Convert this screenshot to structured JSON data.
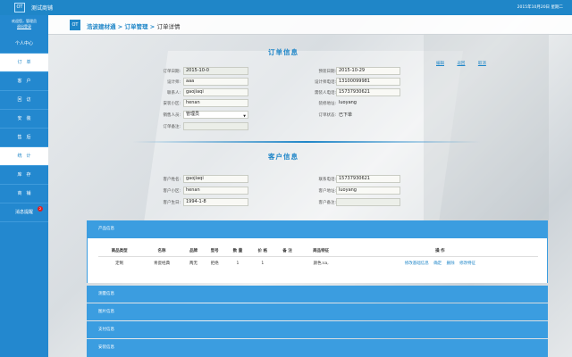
{
  "topbar": {
    "logo": "OT",
    "title": "测试商铺",
    "date": "2015年10月20日 星期二"
  },
  "sidebar": {
    "welcome": "欢迎您，管理员",
    "logout": "退出登录",
    "items": [
      {
        "label": "个人中心"
      },
      {
        "label": "订　单"
      },
      {
        "label": "客　户"
      },
      {
        "label": "回　访"
      },
      {
        "label": "安　装"
      },
      {
        "label": "售　后"
      },
      {
        "label": "统　计"
      },
      {
        "label": "库　存"
      },
      {
        "label": "商　铺"
      },
      {
        "label": "消息提醒",
        "badge": "2"
      }
    ]
  },
  "breadcrumb": {
    "icon": "OT",
    "path": "浩波建材通 > 订单管理 > ",
    "current": "订单详情"
  },
  "order": {
    "title": "订单信息",
    "actions": {
      "edit": "编辑",
      "back": "返回",
      "cancel": "取消"
    },
    "fields": {
      "order_date": {
        "label": "订单日期:",
        "value": "2015-10-0"
      },
      "deliver_date": {
        "label": "预装日期:",
        "value": "2015-10-29"
      },
      "designer": {
        "label": "设计师:",
        "value": "aaa"
      },
      "designer_phone": {
        "label": "设计师电话:",
        "value": "13100099981"
      },
      "contact": {
        "label": "联系人:",
        "value": "gaojiaqi"
      },
      "install_phone": {
        "label": "需装人电话:",
        "value": "15737930621"
      },
      "install_addr": {
        "label": "安装小区:",
        "value": "henan"
      },
      "detail_addr": {
        "label": "装修地址:",
        "value": "luoyang"
      },
      "sales": {
        "label": "销售人员:",
        "value": "管理员"
      },
      "status": {
        "label": "订单状态:",
        "value": "已下单"
      },
      "remark": {
        "label": "订单备注:",
        "value": ""
      }
    }
  },
  "customer": {
    "title": "客户信息",
    "fields": {
      "name": {
        "label": "客户姓名:",
        "value": "gaojiaqi"
      },
      "phone": {
        "label": "联系电话:",
        "value": "15737930621"
      },
      "community": {
        "label": "客户小区:",
        "value": "henan"
      },
      "address": {
        "label": "客户地址:",
        "value": "luoyang"
      },
      "birthday": {
        "label": "客户生日:",
        "value": "1994-1-8"
      },
      "remark": {
        "label": "客户备注:",
        "value": ""
      }
    }
  },
  "products": {
    "title": "产品信息",
    "headers": [
      "商品类型",
      "名称",
      "品牌",
      "型号",
      "数 量",
      "价 格",
      "备 注",
      "商品特征",
      "操 作"
    ],
    "row": {
      "type": "定制",
      "name": "青瓷经典",
      "brand": "两无",
      "model": "拒绝",
      "qty": "1",
      "price": "1",
      "note": "",
      "feature": "颜色:sa,",
      "ops": [
        "修改基础信息",
        "确定",
        "删除",
        "修改特征"
      ]
    }
  },
  "panels": {
    "measure": "测量信息",
    "images": "图片信息",
    "payment": "支付信息",
    "install": "安装信息"
  }
}
